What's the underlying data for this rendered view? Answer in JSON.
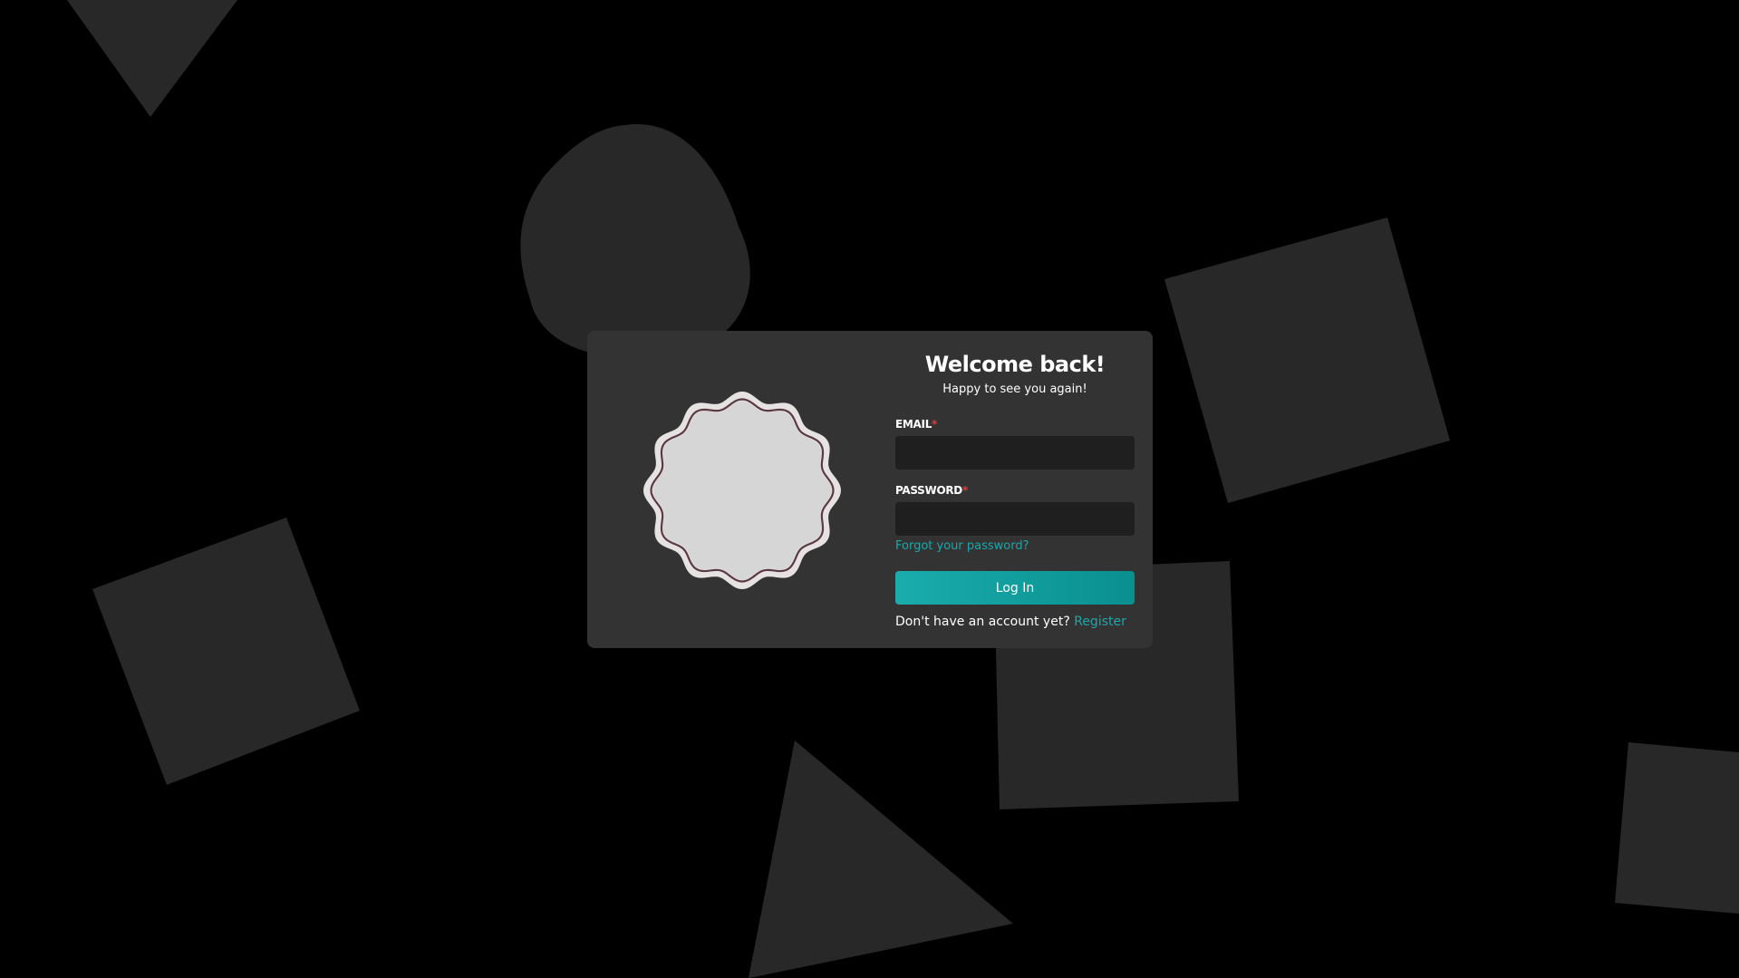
{
  "colors": {
    "page_background": "#000000",
    "shape_fill": "#282828",
    "card_background": "#333333",
    "input_background": "#1f1f1f",
    "accent": "#1ba8a8",
    "button_gradient_start": "#1aacac",
    "button_gradient_end": "#0a8f8f",
    "required_marker": "#e23b3b",
    "badge_fill": "#d6d6d6",
    "badge_ring": "#e6e2e2",
    "badge_line": "#5a3a44"
  },
  "badge": {
    "icon": "wavy-seal-icon"
  },
  "login": {
    "title": "Welcome back!",
    "subtitle": "Happy to see you again!",
    "email_label": "EMAIL",
    "password_label": "PASSWORD",
    "required_mark": "*",
    "email_value": "",
    "password_value": "",
    "forgot_link": "Forgot your password?",
    "submit_label": "Log In",
    "no_account_text": "Don't have an account yet?",
    "register_link": "Register"
  }
}
